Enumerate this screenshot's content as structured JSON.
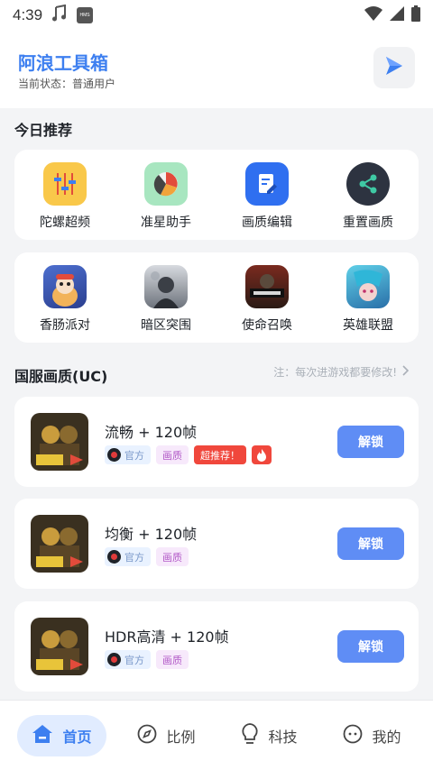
{
  "status_bar": {
    "time": "4:39",
    "hms": "HMS"
  },
  "header": {
    "title": "阿浪工具箱",
    "status": "当前状态：普通用户"
  },
  "recommend": {
    "title": "今日推荐",
    "tools": [
      {
        "label": "陀螺超频",
        "icon": "sliders-icon"
      },
      {
        "label": "准星助手",
        "icon": "pie-chart-icon"
      },
      {
        "label": "画质编辑",
        "icon": "edit-doc-icon"
      },
      {
        "label": "重置画质",
        "icon": "share-icon"
      }
    ],
    "games": [
      {
        "label": "香肠派对",
        "icon": "sausage-party-icon"
      },
      {
        "label": "暗区突围",
        "icon": "arena-breakout-icon"
      },
      {
        "label": "使命召唤",
        "icon": "call-of-duty-icon"
      },
      {
        "label": "英雄联盟",
        "icon": "league-of-legends-icon"
      }
    ]
  },
  "guofu": {
    "title": "国服画质(UC)",
    "note": "注：每次进游戏都要修改!",
    "items": [
      {
        "name": "流畅 + 120帧",
        "tag_official": "官方",
        "tag_quality": "画质",
        "tag_hot": "超推荐！",
        "unlock": "解锁"
      },
      {
        "name": "均衡 + 120帧",
        "tag_official": "官方",
        "tag_quality": "画质",
        "unlock": "解锁"
      },
      {
        "name": "HDR高清 + 120帧",
        "tag_official": "官方",
        "tag_quality": "画质",
        "unlock": "解锁"
      }
    ]
  },
  "nav": [
    {
      "label": "首页",
      "icon": "home-icon",
      "active": true
    },
    {
      "label": "比例",
      "icon": "compass-icon"
    },
    {
      "label": "科技",
      "icon": "bulb-icon"
    },
    {
      "label": "我的",
      "icon": "face-icon"
    }
  ],
  "colors": {
    "accent": "#3d7ff0",
    "button": "#5f8df5",
    "hot": "#f0473c"
  }
}
